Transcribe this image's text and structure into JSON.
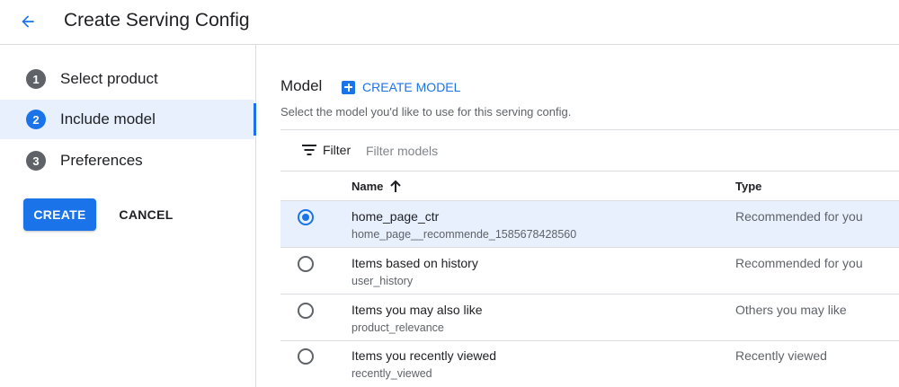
{
  "header": {
    "title": "Create Serving Config",
    "back_icon": "arrow-back-icon"
  },
  "stepper": {
    "steps": [
      {
        "number": "1",
        "label": "Select product",
        "active": false
      },
      {
        "number": "2",
        "label": "Include model",
        "active": true
      },
      {
        "number": "3",
        "label": "Preferences",
        "active": false
      }
    ],
    "create_label": "CREATE",
    "cancel_label": "CANCEL"
  },
  "main": {
    "section_title": "Model",
    "create_model_label": "CREATE MODEL",
    "subtitle": "Select the model you'd like to use for this serving config.",
    "filter": {
      "label": "Filter",
      "placeholder": "Filter models"
    },
    "table": {
      "columns": {
        "name": "Name",
        "type": "Type"
      },
      "sort_icon": "arrow-upward-icon",
      "rows": [
        {
          "name": "home_page_ctr",
          "id": "home_page__recommende_1585678428560",
          "type": "Recommended for you",
          "selected": true
        },
        {
          "name": "Items based on history",
          "id": "user_history",
          "type": "Recommended for you",
          "selected": false
        },
        {
          "name": "Items you may also like",
          "id": "product_relevance",
          "type": "Others you may like",
          "selected": false
        },
        {
          "name": "Items you recently viewed",
          "id": "recently_viewed",
          "type": "Recently viewed",
          "selected": false
        }
      ]
    }
  },
  "colors": {
    "accent": "#1a73e8",
    "selected_bg": "#e8f0fe",
    "text_primary": "#202124",
    "text_secondary": "#5f6368",
    "divider": "#dadce0"
  }
}
